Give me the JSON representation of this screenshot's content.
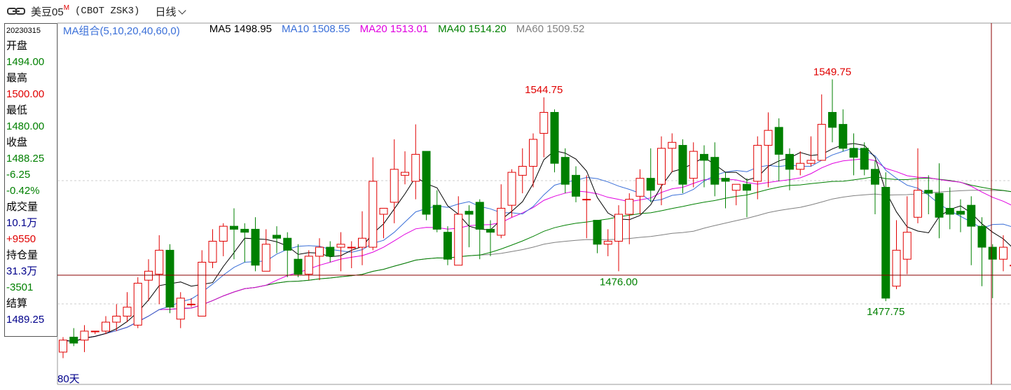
{
  "header": {
    "title": "美豆05",
    "title_sup": "M",
    "code": "(CBOT ZSK3)",
    "period": "日线"
  },
  "info": {
    "date": "20230315",
    "open_label": "开盘",
    "open": "1494.00",
    "high_label": "最高",
    "high": "1500.00",
    "low_label": "最低",
    "low": "1480.00",
    "close_label": "收盘",
    "close": "1488.25",
    "change": "-6.25",
    "change_pct": "-0.42%",
    "volume_label": "成交量",
    "volume": "10.1万",
    "volume_change": "+9550",
    "oi_label": "持仓量",
    "oi": "31.3万",
    "oi_change": "-3501",
    "settle_label": "结算",
    "settle": "1489.25"
  },
  "legend": {
    "combo": "MA组合(5,10,20,40,60,0)",
    "ma5": "MA5 1498.95",
    "ma10": "MA10 1508.55",
    "ma20": "MA20 1513.01",
    "ma40": "MA40 1514.20",
    "ma60": "MA60 1509.52"
  },
  "colors": {
    "up": "#e00000",
    "down": "#008000",
    "ma5": "#000000",
    "ma10": "#3a6fd8",
    "ma20": "#e000e0",
    "ma40": "#008000",
    "ma60": "#808080",
    "crosshair": "#8b0000"
  },
  "days_label": "80天",
  "chart_data": {
    "type": "candlestick",
    "y_range": [
      1455,
      1555
    ],
    "annotations": [
      {
        "text": "1544.75",
        "kind": "high",
        "index": 45
      },
      {
        "text": "1549.75",
        "kind": "high",
        "index": 72
      },
      {
        "text": "1476.00",
        "kind": "low",
        "index": 52
      },
      {
        "text": "1477.75",
        "kind": "low",
        "index": 77
      }
    ],
    "candles": [
      [
        1459,
        1463,
        1457,
        1464
      ],
      [
        1464,
        1462,
        1461,
        1467
      ],
      [
        1463,
        1466,
        1459,
        1468
      ],
      [
        1466,
        1466,
        1465,
        1466
      ],
      [
        1466,
        1469,
        1465,
        1471
      ],
      [
        1469,
        1471,
        1466,
        1475
      ],
      [
        1471,
        1474,
        1469,
        1479
      ],
      [
        1468,
        1482,
        1467,
        1484
      ],
      [
        1483,
        1486,
        1476,
        1490
      ],
      [
        1485,
        1493,
        1475,
        1498
      ],
      [
        1493,
        1474,
        1472,
        1495
      ],
      [
        1470,
        1477,
        1467,
        1479
      ],
      [
        1475,
        1475,
        1474,
        1477
      ],
      [
        1471,
        1489,
        1471,
        1493
      ],
      [
        1489,
        1496,
        1487,
        1500
      ],
      [
        1496,
        1501,
        1491,
        1502
      ],
      [
        1501,
        1500,
        1490,
        1507
      ],
      [
        1500,
        1499,
        1489,
        1502
      ],
      [
        1500,
        1488,
        1486,
        1504
      ],
      [
        1486,
        1495,
        1487,
        1500
      ],
      [
        1498,
        1497,
        1492,
        1501
      ],
      [
        1497,
        1493,
        1484,
        1499
      ],
      [
        1490,
        1485,
        1484,
        1495
      ],
      [
        1485,
        1491,
        1483,
        1493
      ],
      [
        1491,
        1494,
        1483,
        1497
      ],
      [
        1494,
        1491,
        1489,
        1496
      ],
      [
        1494,
        1495,
        1486,
        1499
      ],
      [
        1494,
        1494,
        1487,
        1496
      ],
      [
        1494,
        1497,
        1488,
        1506
      ],
      [
        1494,
        1516,
        1493,
        1524
      ],
      [
        1505,
        1507,
        1497,
        1507
      ],
      [
        1509,
        1520,
        1502,
        1530
      ],
      [
        1518,
        1519,
        1515,
        1526
      ],
      [
        1516,
        1525,
        1510,
        1535
      ],
      [
        1526,
        1505,
        1503,
        1526
      ],
      [
        1508,
        1500,
        1499,
        1513
      ],
      [
        1499,
        1490,
        1488,
        1501
      ],
      [
        1488,
        1505,
        1496,
        1511
      ],
      [
        1506,
        1505,
        1494,
        1508
      ],
      [
        1509,
        1500,
        1490,
        1510
      ],
      [
        1500,
        1499,
        1491,
        1503
      ],
      [
        1498,
        1507,
        1497,
        1515
      ],
      [
        1508,
        1519,
        1504,
        1520
      ],
      [
        1518,
        1521,
        1512,
        1527
      ],
      [
        1521,
        1530,
        1514,
        1532
      ],
      [
        1532,
        1539,
        1524,
        1544
      ],
      [
        1539,
        1522,
        1519,
        1540
      ],
      [
        1524,
        1515,
        1512,
        1527
      ],
      [
        1518,
        1511,
        1509,
        1521
      ],
      [
        1510,
        1510,
        1497,
        1518
      ],
      [
        1503,
        1495,
        1492,
        1503
      ],
      [
        1495,
        1496,
        1491,
        1500
      ],
      [
        1496,
        1505,
        1486,
        1508
      ],
      [
        1505,
        1510,
        1495,
        1512
      ],
      [
        1511,
        1517,
        1505,
        1520
      ],
      [
        1517,
        1513,
        1509,
        1527
      ],
      [
        1515,
        1527,
        1508,
        1531
      ],
      [
        1527,
        1529,
        1519,
        1532
      ],
      [
        1528,
        1515,
        1512,
        1530
      ],
      [
        1517,
        1526,
        1514,
        1529
      ],
      [
        1525,
        1523,
        1514,
        1528
      ],
      [
        1524,
        1515,
        1511,
        1529
      ],
      [
        1517,
        1516,
        1507,
        1519
      ],
      [
        1513,
        1515,
        1508,
        1515
      ],
      [
        1515,
        1513,
        1504,
        1517
      ],
      [
        1516,
        1528,
        1510,
        1531
      ],
      [
        1528,
        1533,
        1514,
        1539
      ],
      [
        1534,
        1525,
        1516,
        1537
      ],
      [
        1525,
        1520,
        1513,
        1527
      ],
      [
        1520,
        1522,
        1518,
        1526
      ],
      [
        1522,
        1523,
        1521,
        1531
      ],
      [
        1523,
        1535,
        1524,
        1545
      ],
      [
        1539,
        1534,
        1529,
        1550
      ],
      [
        1535,
        1527,
        1526,
        1540
      ],
      [
        1527,
        1524,
        1518,
        1532
      ],
      [
        1527,
        1520,
        1518,
        1529
      ],
      [
        1520,
        1515,
        1505,
        1523
      ],
      [
        1514,
        1477,
        1476,
        1519
      ],
      [
        1481,
        1493,
        1480,
        1503
      ],
      [
        1490,
        1499,
        1485,
        1511
      ],
      [
        1504,
        1513,
        1502,
        1527
      ],
      [
        1513,
        1512,
        1505,
        1518
      ],
      [
        1512,
        1504,
        1497,
        1522
      ],
      [
        1507,
        1505,
        1500,
        1514
      ],
      [
        1506,
        1505,
        1499,
        1510
      ],
      [
        1508,
        1501,
        1488,
        1511
      ],
      [
        1501,
        1494,
        1481,
        1504
      ],
      [
        1494,
        1490,
        1477,
        1495
      ],
      [
        1490,
        1494,
        1486,
        1498
      ],
      [
        1488,
        1488,
        1480,
        1500
      ]
    ]
  }
}
